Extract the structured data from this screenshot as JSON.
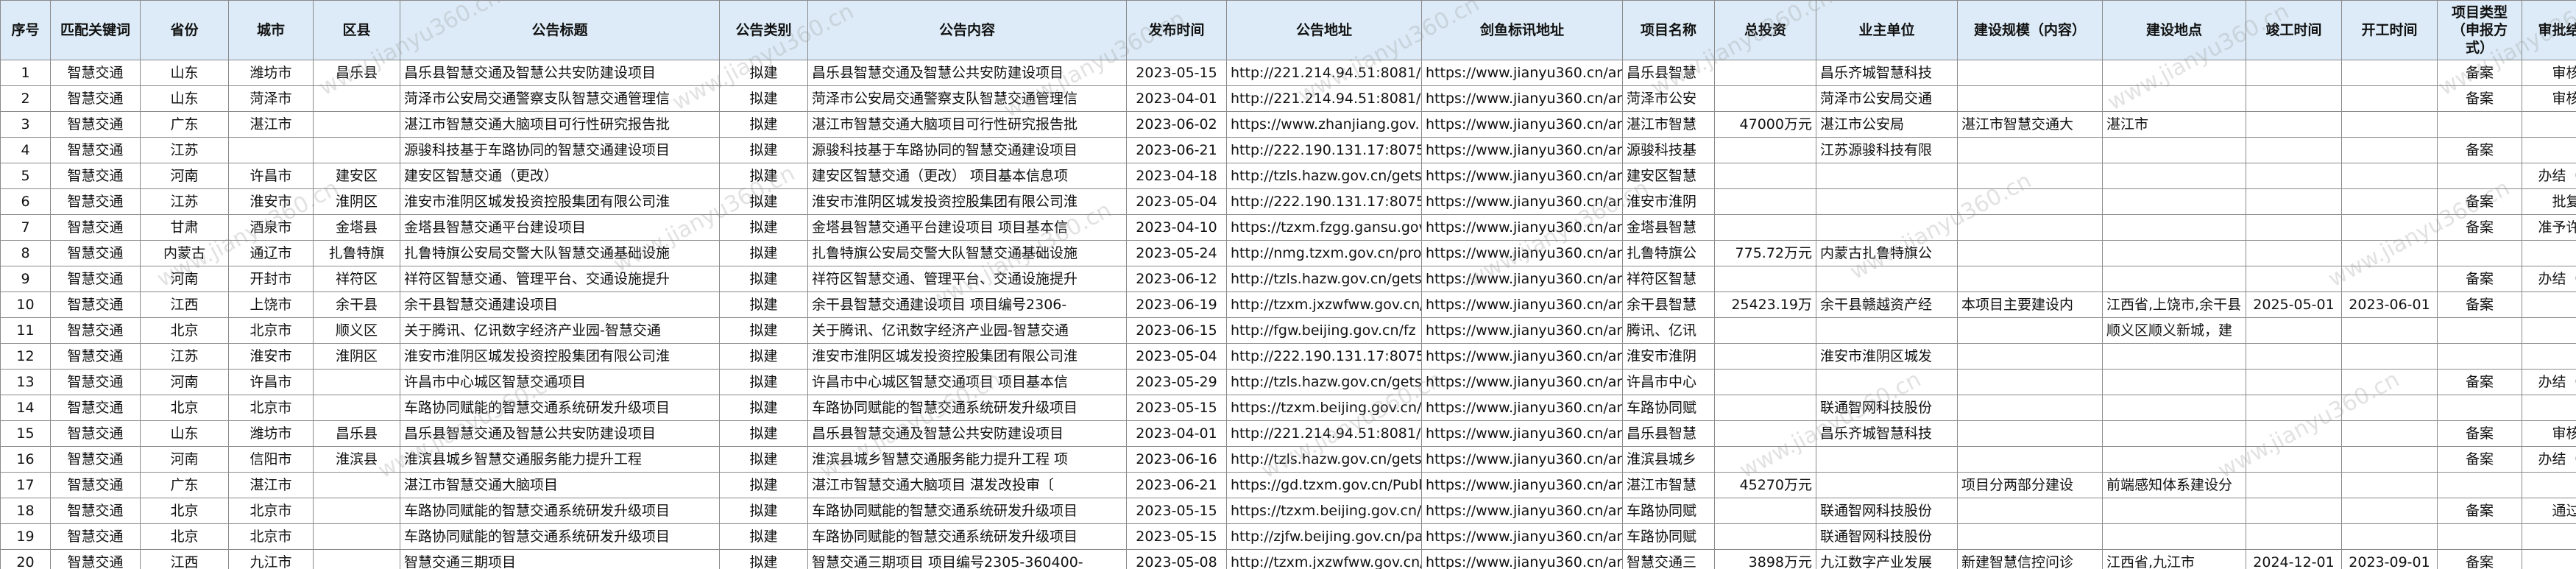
{
  "columns": [
    "序号",
    "匹配关键词",
    "省份",
    "城市",
    "区县",
    "公告标题",
    "公告类别",
    "公告内容",
    "发布时间",
    "公告地址",
    "剑鱼标讯地址",
    "项目名称",
    "总投资",
    "业主单位",
    "建设规模（内容）",
    "建设地点",
    "竣工时间",
    "开工时间",
    "项目类型（申报方式）",
    "审批结果"
  ],
  "rows": [
    [
      "1",
      "智慧交通",
      "山东",
      "潍坊市",
      "昌乐县",
      "昌乐县智慧交通及智慧公共安防建设项目",
      "拟建",
      "昌乐县智慧交通及智慧公共安防建设项目",
      "2023-05-15",
      "http://221.214.94.51:8081/ici",
      "https://www.jianyu360.cn/ar",
      "昌乐县智慧",
      "",
      "昌乐齐城智慧科技",
      "",
      "",
      "",
      "",
      "备案",
      "审核"
    ],
    [
      "2",
      "智慧交通",
      "山东",
      "菏泽市",
      "",
      "菏泽市公安局交通警察支队智慧交通管理信",
      "拟建",
      "菏泽市公安局交通警察支队智慧交通管理信",
      "2023-04-01",
      "http://221.214.94.51:8081/ici",
      "https://www.jianyu360.cn/ar",
      "菏泽市公安",
      "",
      "菏泽市公安局交通",
      "",
      "",
      "",
      "",
      "备案",
      "审核"
    ],
    [
      "3",
      "智慧交通",
      "广东",
      "湛江市",
      "",
      "湛江市智慧交通大脑项目可行性研究报告批",
      "拟建",
      "湛江市智慧交通大脑项目可行性研究报告批",
      "2023-06-02",
      "https://www.zhanjiang.gov.",
      "https://www.jianyu360.cn/ar",
      "湛江市智慧",
      "47000万元",
      "湛江市公安局",
      "湛江市智慧交通大",
      "湛江市",
      "",
      "",
      "",
      ""
    ],
    [
      "4",
      "智慧交通",
      "江苏",
      "",
      "",
      "源骏科技基于车路协同的智慧交通建设项目",
      "拟建",
      "源骏科技基于车路协同的智慧交通建设项目",
      "2023-06-21",
      "http://222.190.131.17:8075/",
      "https://www.jianyu360.cn/ar",
      "源骏科技基",
      "",
      "江苏源骏科技有限",
      "",
      "",
      "",
      "",
      "备案",
      ""
    ],
    [
      "5",
      "智慧交通",
      "河南",
      "许昌市",
      "建安区",
      "建安区智慧交通（更改）",
      "拟建",
      "建安区智慧交通（更改） 项目基本信息项",
      "2023-04-18",
      "http://tzls.hazw.gov.cn/gets",
      "https://www.jianyu360.cn/ar",
      "建安区智慧",
      "",
      "",
      "",
      "",
      "",
      "",
      "",
      "办结（通"
    ],
    [
      "6",
      "智慧交通",
      "江苏",
      "淮安市",
      "淮阴区",
      "淮安市淮阴区城发投资控股集团有限公司淮",
      "拟建",
      "淮安市淮阴区城发投资控股集团有限公司淮",
      "2023-05-04",
      "http://222.190.131.17:8075/",
      "https://www.jianyu360.cn/ar",
      "淮安市淮阴",
      "",
      "",
      "",
      "",
      "",
      "",
      "备案",
      "批复"
    ],
    [
      "7",
      "智慧交通",
      "甘肃",
      "酒泉市",
      "金塔县",
      "金塔县智慧交通平台建设项目",
      "拟建",
      "金塔县智慧交通平台建设项目 项目基本信",
      "2023-04-10",
      "https://tzxm.fzgg.gansu.gov",
      "https://www.jianyu360.cn/ar",
      "金塔县智慧",
      "",
      "",
      "",
      "",
      "",
      "",
      "备案",
      "准予许可"
    ],
    [
      "8",
      "智慧交通",
      "内蒙古",
      "通辽市",
      "扎鲁特旗",
      "扎鲁特旗公安局交警大队智慧交通基础设施",
      "拟建",
      "扎鲁特旗公安局交警大队智慧交通基础设施",
      "2023-05-24",
      "http://nmg.tzxm.gov.cn/pro",
      "https://www.jianyu360.cn/ar",
      "扎鲁特旗公",
      "775.72万元",
      "内蒙古扎鲁特旗公",
      "",
      "",
      "",
      "",
      "",
      ""
    ],
    [
      "9",
      "智慧交通",
      "河南",
      "开封市",
      "祥符区",
      "祥符区智慧交通、管理平台、交通设施提升",
      "拟建",
      "祥符区智慧交通、管理平台、交通设施提升",
      "2023-06-12",
      "http://tzls.hazw.gov.cn/gets",
      "https://www.jianyu360.cn/ar",
      "祥符区智慧",
      "",
      "",
      "",
      "",
      "",
      "",
      "备案",
      "办结（通"
    ],
    [
      "10",
      "智慧交通",
      "江西",
      "上饶市",
      "余干县",
      "余干县智慧交通建设项目",
      "拟建",
      "余干县智慧交通建设项目 项目编号2306-",
      "2023-06-19",
      "http://tzxm.jxzwfww.gov.cn/",
      "https://www.jianyu360.cn/ar",
      "余干县智慧",
      "25423.19万",
      "余干县赣越资产经",
      "本项目主要建设内",
      "江西省,上饶市,余干县",
      "2025-05-01",
      "2023-06-01",
      "备案",
      ""
    ],
    [
      "11",
      "智慧交通",
      "北京",
      "北京市",
      "顺义区",
      "关于腾讯、亿讯数字经济产业园-智慧交通",
      "拟建",
      "关于腾讯、亿讯数字经济产业园-智慧交通",
      "2023-06-15",
      "http://fgw.beijing.gov.cn/fz",
      "https://www.jianyu360.cn/ar",
      "腾讯、亿讯",
      "",
      "",
      "",
      "顺义区顺义新城，建",
      "",
      "",
      "",
      ""
    ],
    [
      "12",
      "智慧交通",
      "江苏",
      "淮安市",
      "淮阴区",
      "淮安市淮阴区城发投资控股集团有限公司淮",
      "拟建",
      "淮安市淮阴区城发投资控股集团有限公司淮",
      "2023-05-04",
      "http://222.190.131.17:8075/",
      "https://www.jianyu360.cn/ar",
      "淮安市淮阴",
      "",
      "淮安市淮阴区城发",
      "",
      "",
      "",
      "",
      "",
      ""
    ],
    [
      "13",
      "智慧交通",
      "河南",
      "许昌市",
      "",
      "许昌市中心城区智慧交通项目",
      "拟建",
      "许昌市中心城区智慧交通项目 项目基本信",
      "2023-05-29",
      "http://tzls.hazw.gov.cn/gets",
      "https://www.jianyu360.cn/ar",
      "许昌市中心",
      "",
      "",
      "",
      "",
      "",
      "",
      "备案",
      "办结（通"
    ],
    [
      "14",
      "智慧交通",
      "北京",
      "北京市",
      "",
      "车路协同赋能的智慧交通系统研发升级项目",
      "拟建",
      "车路协同赋能的智慧交通系统研发升级项目",
      "2023-05-15",
      "https://tzxm.beijing.gov.cn/i",
      "https://www.jianyu360.cn/ar",
      "车路协同赋",
      "",
      "联通智网科技股份",
      "",
      "",
      "",
      "",
      "",
      ""
    ],
    [
      "15",
      "智慧交通",
      "山东",
      "潍坊市",
      "昌乐县",
      "昌乐县智慧交通及智慧公共安防建设项目",
      "拟建",
      "昌乐县智慧交通及智慧公共安防建设项目",
      "2023-04-01",
      "http://221.214.94.51:8081/ici",
      "https://www.jianyu360.cn/ar",
      "昌乐县智慧",
      "",
      "昌乐齐城智慧科技",
      "",
      "",
      "",
      "",
      "备案",
      "审核"
    ],
    [
      "16",
      "智慧交通",
      "河南",
      "信阳市",
      "淮滨县",
      "淮滨县城乡智慧交通服务能力提升工程",
      "拟建",
      "淮滨县城乡智慧交通服务能力提升工程 项",
      "2023-06-16",
      "http://tzls.hazw.gov.cn/gets",
      "https://www.jianyu360.cn/ar",
      "淮滨县城乡",
      "",
      "",
      "",
      "",
      "",
      "",
      "备案",
      "办结（通"
    ],
    [
      "17",
      "智慧交通",
      "广东",
      "湛江市",
      "",
      "湛江市智慧交通大脑项目",
      "拟建",
      "湛江市智慧交通大脑项目 湛发改投审〔",
      "2023-06-21",
      "https://gd.tzxm.gov.cn/Publ",
      "https://www.jianyu360.cn/ar",
      "湛江市智慧",
      "45270万元",
      "",
      "项目分两部分建设",
      "前端感知体系建设分",
      "",
      "",
      "",
      ""
    ],
    [
      "18",
      "智慧交通",
      "北京",
      "北京市",
      "",
      "车路协同赋能的智慧交通系统研发升级项目",
      "拟建",
      "车路协同赋能的智慧交通系统研发升级项目",
      "2023-05-15",
      "https://tzxm.beijing.gov.cn/i",
      "https://www.jianyu360.cn/ar",
      "车路协同赋",
      "",
      "联通智网科技股份",
      "",
      "",
      "",
      "",
      "备案",
      "通过"
    ],
    [
      "19",
      "智慧交通",
      "北京",
      "北京市",
      "",
      "车路协同赋能的智慧交通系统研发升级项目",
      "拟建",
      "车路协同赋能的智慧交通系统研发升级项目",
      "2023-05-15",
      "http://zjfw.beijing.gov.cn/pa",
      "https://www.jianyu360.cn/ar",
      "车路协同赋",
      "",
      "联通智网科技股份",
      "",
      "",
      "",
      "",
      "",
      ""
    ],
    [
      "20",
      "智慧交通",
      "江西",
      "九江市",
      "",
      "智慧交通三期项目",
      "拟建",
      "智慧交通三期项目 项目编号2305-360400-",
      "2023-05-08",
      "http://tzxm.jxzwfww.gov.cn/",
      "https://www.jianyu360.cn/ar",
      "智慧交通三",
      "3898万元",
      "九江数字产业发展",
      "新建智慧信控问诊",
      "江西省,九江市",
      "2024-12-01",
      "2023-09-01",
      "备案",
      ""
    ]
  ],
  "watermark": "www.jianyu360.cn"
}
